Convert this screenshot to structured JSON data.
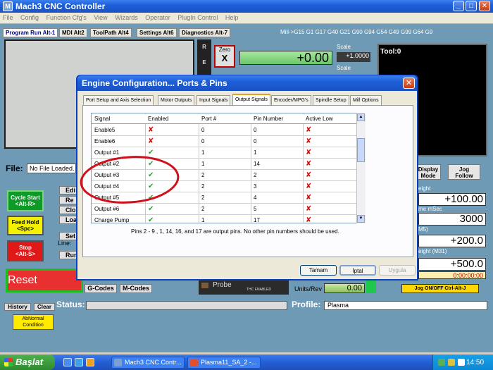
{
  "window": {
    "title": "Mach3 CNC Controller",
    "app_icon": "M"
  },
  "menu": [
    "File",
    "Config",
    "Function Cfg's",
    "View",
    "Wizards",
    "Operator",
    "PlugIn Control",
    "Help"
  ],
  "main_tabs": [
    "Program Run Alt-1",
    "MDI Alt2",
    "ToolPath Alt4",
    "Settings Alt6",
    "Diagnostics Alt-7"
  ],
  "gcode_line": "Mill->G15  G1 G17 G40 G21 G90 G94 G54 G49 G99 G64 G9",
  "dro": {
    "strip_letters": "R E F A L",
    "zero_label": "Zero",
    "zero_axis": "X",
    "x_value": "+0.00",
    "scale_label": "Scale",
    "scale_value": "+1.0000",
    "scale_label_2": "Scale"
  },
  "tool_label": "Tool:0",
  "file": {
    "label": "File:",
    "value": "No File Loaded."
  },
  "left_buttons": {
    "cycle_start": [
      "Cycle Start",
      "<Alt-R>"
    ],
    "feed_hold": [
      "Feed Hold",
      "<Spc>"
    ],
    "stop": [
      "Stop",
      "<Alt-S>"
    ],
    "reset": "Reset"
  },
  "side_buttons": [
    "Edi",
    "Re",
    "Clos",
    "Loa",
    "Set",
    "Run"
  ],
  "line_label": "Line:",
  "code_buttons": {
    "gcodes": "G-Codes",
    "mcodes": "M-Codes"
  },
  "probe": {
    "label": "Probe",
    "thc": "THC ENABLED"
  },
  "units": {
    "label": "Units/Rev",
    "value": "0.00"
  },
  "jog_onoff": "Jog ON/OFF Ctrl-Alt-J",
  "right_panel": {
    "display_mode": [
      "Display",
      "Mode"
    ],
    "jog_follow": [
      "Jog",
      "Follow"
    ],
    "label_1": "eight",
    "value_1": "+100.00",
    "label_2": "me mSec",
    "value_2": "3000",
    "label_3": "M5)",
    "value_3": "+200.0",
    "label_4": "eight (M31)",
    "value_4": "+500.0",
    "time": "0:00:00:00"
  },
  "bottom": {
    "history": "History",
    "clear": "Clear",
    "status_label": "Status:",
    "profile_label": "Profile:",
    "profile_value": "Plasma",
    "abnormal": [
      "AbNormal",
      "Condition"
    ]
  },
  "dialog": {
    "title": "Engine Configuration... Ports & Pins",
    "close_glyph": "✕",
    "tabs": [
      "Port Setup and Axis Selection",
      "Motor Outputs",
      "Input Signals",
      "Output Signals",
      "Encoder/MPG's",
      "Spindle Setup",
      "Mill Options"
    ],
    "active_tab": 3,
    "columns": [
      "Signal",
      "Enabled",
      "Port #",
      "Pin Number",
      "Active Low"
    ],
    "rows": [
      {
        "signal": "Enable5",
        "enabled": false,
        "port": "0",
        "pin": "0",
        "active_low": false
      },
      {
        "signal": "Enable6",
        "enabled": false,
        "port": "0",
        "pin": "0",
        "active_low": false
      },
      {
        "signal": "Output #1",
        "enabled": true,
        "port": "1",
        "pin": "1",
        "active_low": false
      },
      {
        "signal": "Output #2",
        "enabled": true,
        "port": "1",
        "pin": "14",
        "active_low": false
      },
      {
        "signal": "Output #3",
        "enabled": true,
        "port": "2",
        "pin": "2",
        "active_low": false
      },
      {
        "signal": "Output #4",
        "enabled": true,
        "port": "2",
        "pin": "3",
        "active_low": false
      },
      {
        "signal": "Output #5",
        "enabled": true,
        "port": "2",
        "pin": "4",
        "active_low": false
      },
      {
        "signal": "Output #6",
        "enabled": true,
        "port": "2",
        "pin": "5",
        "active_low": false
      },
      {
        "signal": "Charge Pump",
        "enabled": true,
        "port": "1",
        "pin": "17",
        "active_low": false
      }
    ],
    "note": "Pins 2 - 9 , 1, 14, 16, and 17 are output pins.  No  other pin numbers should be used.",
    "buttons": {
      "ok": "Tamam",
      "cancel": "İptal",
      "apply": "Uygula"
    }
  },
  "taskbar": {
    "start": "Başlat",
    "tasks": [
      "Mach3 CNC Contr...",
      "Plasma11_SA_2 -..."
    ],
    "clock": "14:50"
  },
  "colors": {
    "title_blue": "#1d5fd8",
    "main_bg": "#6f9ab5",
    "annotation_red": "#d0101a",
    "check_green": "#2aa52a"
  }
}
